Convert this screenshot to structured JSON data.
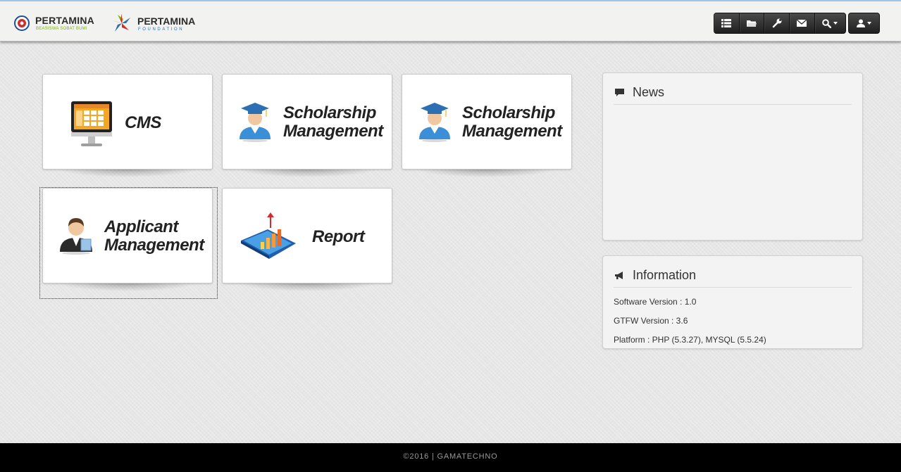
{
  "header": {
    "logo_left": {
      "name": "PERTAMINA",
      "tagline": "BEASISWA SOBAT BUMI"
    },
    "logo_right": {
      "name": "PERTAMINA",
      "tagline": "FOUNDATION"
    },
    "toolbar_icons": [
      "list-icon",
      "folder-icon",
      "wrench-icon",
      "envelope-icon",
      "search-icon"
    ],
    "user_icon": "user-icon"
  },
  "tiles": [
    {
      "label": "CMS",
      "icon": "monitor-icon"
    },
    {
      "label_line1": "Scholarship",
      "label_line2": "Management",
      "icon": "graduate-icon"
    },
    {
      "label_line1": "Scholarship",
      "label_line2": "Management",
      "icon": "graduate-icon"
    },
    {
      "label_line1": "Applicant",
      "label_line2": "Management",
      "icon": "applicant-icon"
    },
    {
      "label": "Report",
      "icon": "report-chart-icon"
    }
  ],
  "news": {
    "title": "News"
  },
  "information": {
    "title": "Information",
    "lines": [
      "Software Version : 1.0",
      "GTFW Version : 3.6",
      "Platform : PHP (5.3.27), MYSQL (5.5.24)"
    ]
  },
  "footer": {
    "text": "©2016 | GAMATECHNO"
  },
  "colors": {
    "header_bg": "#f2f2f0",
    "toolbar_bg": "#2b2b2b",
    "footer_bg": "#000000",
    "accent_blue": "#3a8fd6"
  }
}
